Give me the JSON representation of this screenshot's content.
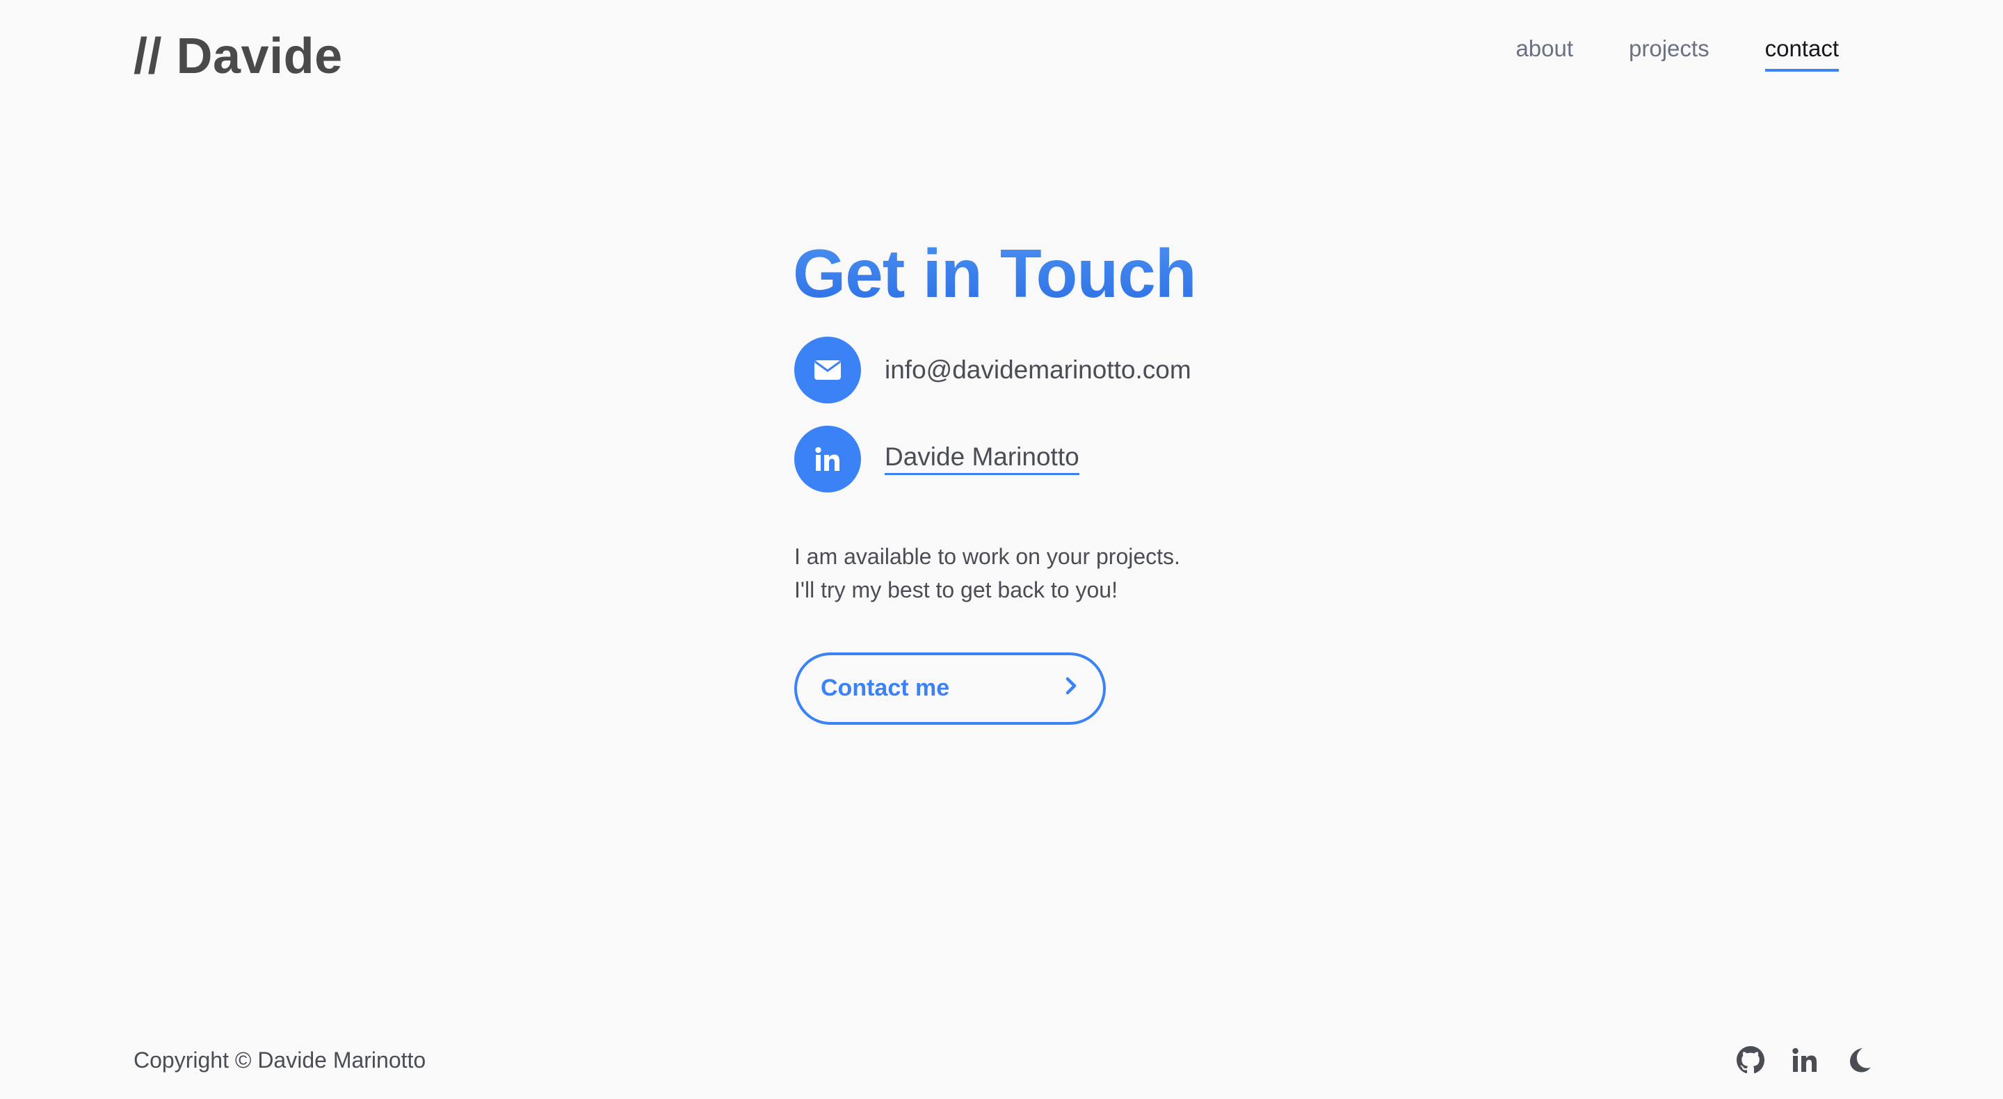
{
  "header": {
    "logo": "// Davide",
    "nav": [
      {
        "label": "about"
      },
      {
        "label": "projects"
      },
      {
        "label": "contact"
      }
    ]
  },
  "contact": {
    "title": "Get in Touch",
    "email": "info@davidemarinotto.com",
    "linkedin_name": "Davide Marinotto",
    "description_line1": "I am available to work on your projects.",
    "description_line2": "I'll try my best to get back to you!",
    "cta_label": "Contact me"
  },
  "footer": {
    "copyright": "Copyright © Davide Marinotto",
    "icons": [
      "github-icon",
      "linkedin-icon",
      "moon-icon"
    ]
  },
  "colors": {
    "accent": "#3b82f6",
    "text": "#4b4d55",
    "background": "#f9f9fa"
  }
}
